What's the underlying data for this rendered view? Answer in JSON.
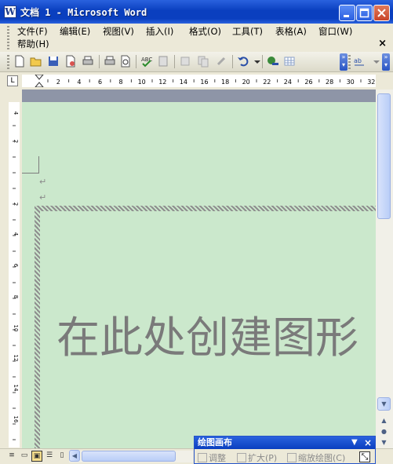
{
  "window": {
    "title": "文档 1 - Microsoft Word",
    "app_icon_letter": "W",
    "controls": [
      "minimize",
      "maximize",
      "close"
    ]
  },
  "menu": {
    "items_row1": [
      "文件(F)",
      "编辑(E)",
      "视图(V)",
      "插入(I)",
      "格式(O)",
      "工具(T)",
      "表格(A)",
      "窗口(W)"
    ],
    "items_row2": [
      "帮助(H)"
    ],
    "doc_close": "×"
  },
  "toolbar": {
    "icons": [
      "new-doc-icon",
      "open-icon",
      "save-icon",
      "permission-icon",
      "print-icon",
      "print-preview-icon",
      "spelling-icon",
      "research-icon",
      "cut-icon",
      "copy-icon",
      "paste-icon",
      "format-painter-icon",
      "undo-icon",
      "undo-dropdown-icon",
      "hyperlink-icon",
      "table-icon",
      "text-icon",
      "overflow-icon"
    ]
  },
  "rulers": {
    "horizontal_labels": [
      "2",
      "4",
      "6",
      "8",
      "10",
      "12",
      "14",
      "16",
      "18",
      "20",
      "22",
      "24",
      "26",
      "28",
      "30",
      "32"
    ],
    "vertical_labels": [
      "4",
      "2",
      "2",
      "4",
      "6",
      "8",
      "10",
      "12",
      "14",
      "16"
    ],
    "tab_selector": "L"
  },
  "document": {
    "canvas_placeholder": "在此处创建图形",
    "paragraph_mark": "↵"
  },
  "drawing_toolbar": {
    "title": "绘图画布",
    "buttons": [
      "调整",
      "扩大(P)",
      "缩放绘图(C)"
    ],
    "dropdown": "▼",
    "close": "×"
  },
  "view_buttons": [
    "normal-view",
    "web-layout-view",
    "print-layout-view",
    "outline-view",
    "reading-view"
  ]
}
